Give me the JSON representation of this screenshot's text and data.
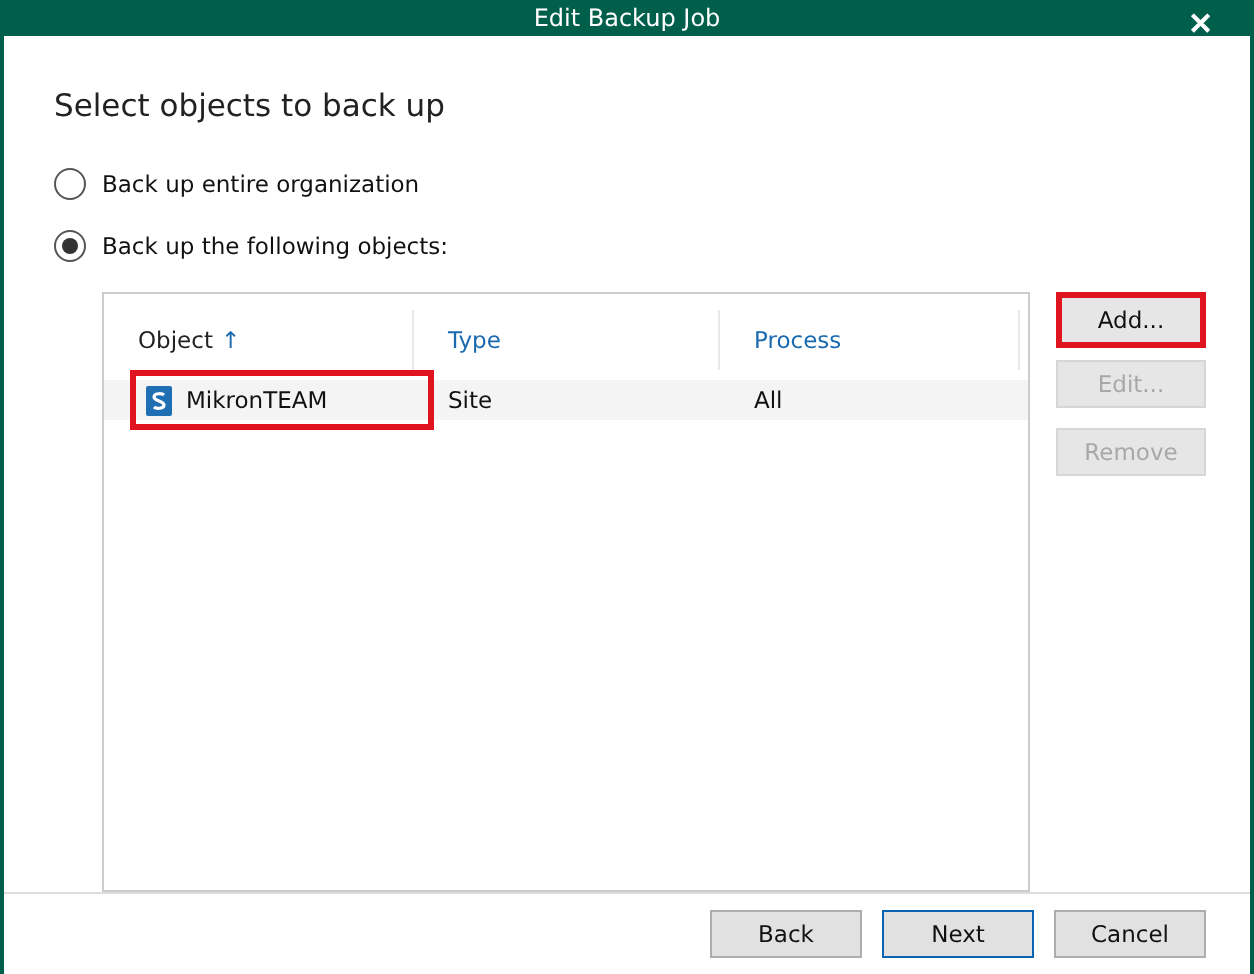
{
  "window": {
    "title": "Edit Backup Job",
    "close": "✕"
  },
  "heading": "Select objects to back up",
  "options": [
    {
      "label": "Back up entire organization",
      "selected": false
    },
    {
      "label": "Back up the following objects:",
      "selected": true
    }
  ],
  "table": {
    "columns": [
      {
        "label": "Object",
        "sort": "↑",
        "sorted": true
      },
      {
        "label": "Type",
        "sorted": false
      },
      {
        "label": "Process",
        "sorted": false
      }
    ],
    "rows": [
      {
        "cells": [
          "MikronTEAM",
          "Site",
          "All"
        ],
        "highlighted": true
      }
    ]
  },
  "side_buttons": [
    {
      "label": "Add...",
      "disabled": false,
      "highlighted": true
    },
    {
      "label": "Edit...",
      "disabled": true,
      "highlighted": false
    },
    {
      "label": "Remove",
      "disabled": true,
      "highlighted": false
    }
  ],
  "footer_buttons": [
    {
      "label": "Back",
      "default": false
    },
    {
      "label": "Next",
      "default": true
    },
    {
      "label": "Cancel",
      "default": false
    }
  ]
}
